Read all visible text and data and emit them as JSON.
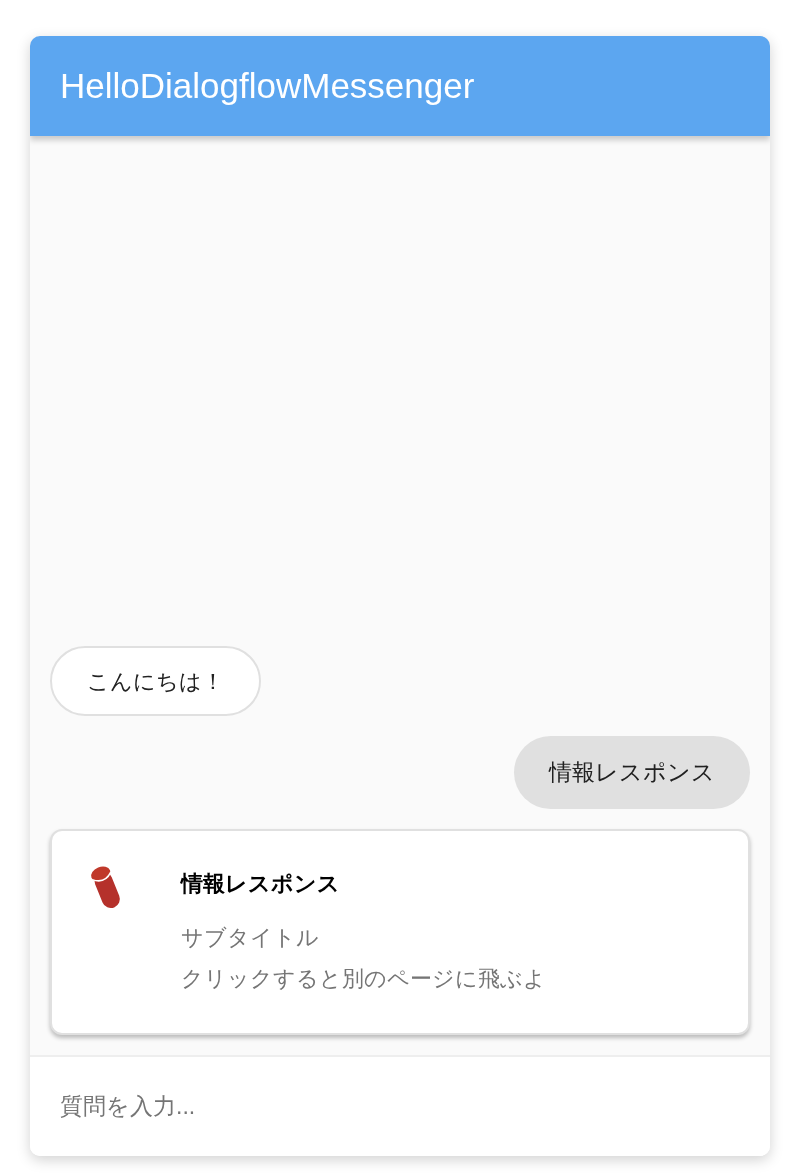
{
  "window": {
    "title": "HelloDialogflowMessenger"
  },
  "messages": [
    {
      "kind": "bot",
      "text": "こんにちは！"
    },
    {
      "kind": "user",
      "text": "情報レスポンス"
    },
    {
      "kind": "info_card",
      "title": "情報レスポンス",
      "subtitle": "サブタイトル",
      "description": "クリックすると別のページに飛ぶよ"
    }
  ],
  "input": {
    "placeholder": "質問を入力..."
  }
}
